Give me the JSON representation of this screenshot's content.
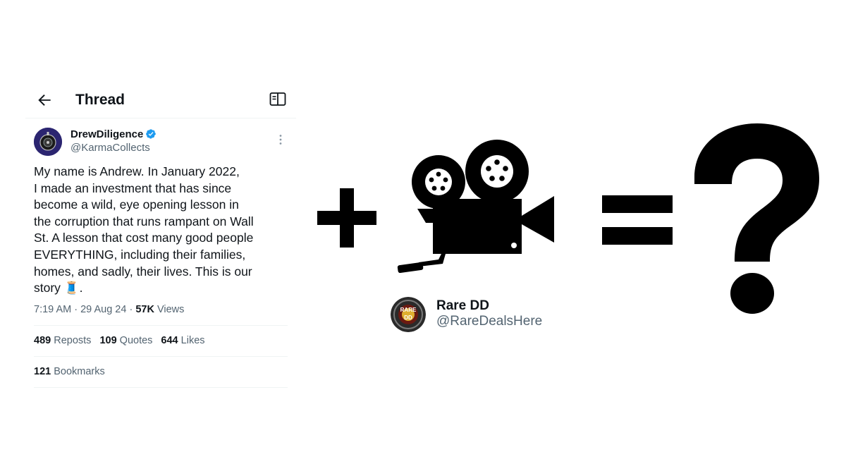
{
  "header": {
    "title": "Thread"
  },
  "tweet": {
    "display_name": "DrewDiligence",
    "handle": "@KarmaCollects",
    "text": "My name is Andrew. In January 2022,\nI made an investment that has since\nbecome a wild, eye opening lesson in\nthe corruption that runs rampant on Wall\nSt. A lesson that cost many good people\nEVERYTHING, including their families,\nhomes, and sadly, their lives. This is our\nstory 🧵.",
    "time": "7:19 AM",
    "date": "29 Aug 24",
    "views_count": "57K",
    "views_label": "Views",
    "separator": "·",
    "stats": [
      {
        "count": "489",
        "label": "Reposts"
      },
      {
        "count": "109",
        "label": "Quotes"
      },
      {
        "count": "644",
        "label": "Likes"
      }
    ],
    "bookmarks": {
      "count": "121",
      "label": "Bookmarks"
    }
  },
  "rare_card": {
    "display_name": "Rare DD",
    "handle": "@RareDealsHere",
    "avatar_text_top": "RARE",
    "avatar_text_bottom": "DD"
  },
  "icons": {
    "back": "arrow-left-icon",
    "reader": "reader-mode-icon",
    "verified": "verified-badge-icon",
    "more": "more-dots-icon",
    "plus": "plus-icon",
    "camera": "movie-camera-icon",
    "equals": "equals-icon",
    "question": "question-mark-icon"
  },
  "colors": {
    "verified": "#1d9bf0",
    "secondary_text": "#536471",
    "primary_text": "#0f1419",
    "avatar_bg": "#2e2a7a"
  }
}
